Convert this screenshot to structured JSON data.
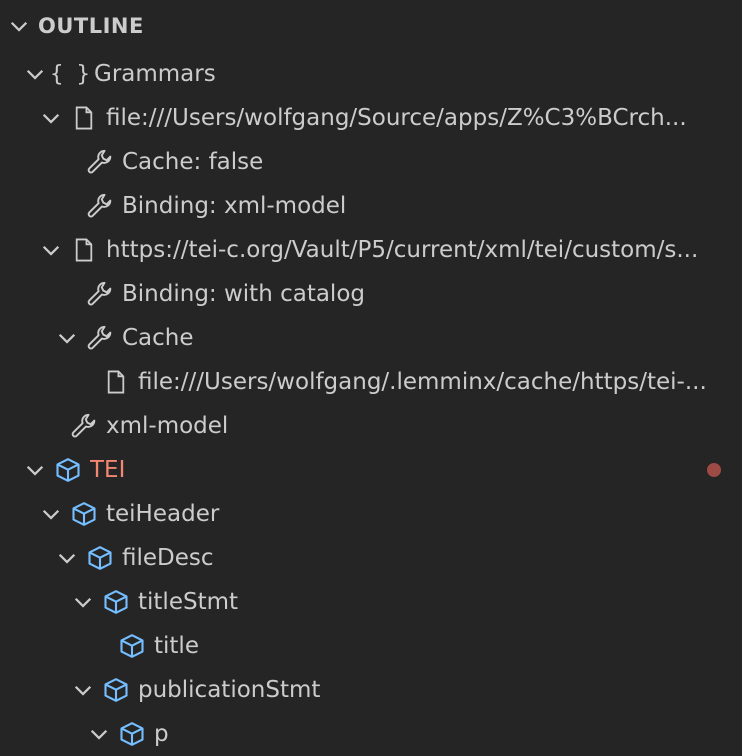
{
  "panel": {
    "title": "OUTLINE"
  },
  "colors": {
    "background": "#252526",
    "text": "#cccccc",
    "error_text": "#f48771",
    "element_icon": "#75beff",
    "error_dot": "#9e4a45"
  },
  "tree": [
    {
      "label": "Grammars",
      "icon": "braces-icon",
      "level": 0,
      "twistie": "expanded"
    },
    {
      "label": "file:///Users/wolfgang/Source/apps/Z%C3%BCrch...",
      "icon": "file-icon",
      "level": 1,
      "twistie": "expanded"
    },
    {
      "label": "Cache: false",
      "icon": "wrench-icon",
      "level": 2,
      "twistie": "none"
    },
    {
      "label": "Binding: xml-model",
      "icon": "wrench-icon",
      "level": 2,
      "twistie": "none"
    },
    {
      "label": "https://tei-c.org/Vault/P5/current/xml/tei/custom/s...",
      "icon": "file-icon",
      "level": 1,
      "twistie": "expanded"
    },
    {
      "label": "Binding: with catalog",
      "icon": "wrench-icon",
      "level": 2,
      "twistie": "none"
    },
    {
      "label": "Cache",
      "icon": "wrench-icon",
      "level": 2,
      "twistie": "expanded"
    },
    {
      "label": "file:///Users/wolfgang/.lemminx/cache/https/tei-...",
      "icon": "file-icon",
      "level": 3,
      "twistie": "none"
    },
    {
      "label": "xml-model",
      "icon": "wrench-icon",
      "level": 1,
      "twistie": "none"
    },
    {
      "label": "TEI",
      "icon": "element-icon",
      "level": 0,
      "twistie": "expanded",
      "error": true
    },
    {
      "label": "teiHeader",
      "icon": "element-icon",
      "level": 1,
      "twistie": "expanded"
    },
    {
      "label": "fileDesc",
      "icon": "element-icon",
      "level": 2,
      "twistie": "expanded"
    },
    {
      "label": "titleStmt",
      "icon": "element-icon",
      "level": 3,
      "twistie": "expanded"
    },
    {
      "label": "title",
      "icon": "element-icon",
      "level": 4,
      "twistie": "none"
    },
    {
      "label": "publicationStmt",
      "icon": "element-icon",
      "level": 3,
      "twistie": "expanded"
    },
    {
      "label": "p",
      "icon": "element-icon",
      "level": 4,
      "twistie": "expanded"
    }
  ]
}
